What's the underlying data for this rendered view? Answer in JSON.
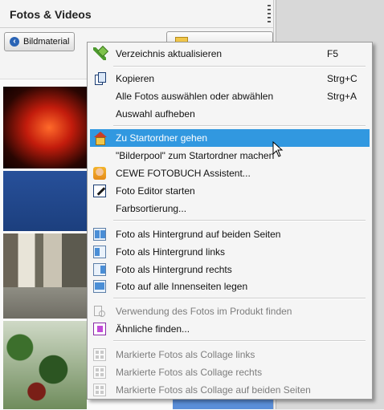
{
  "panel": {
    "title": "Fotos & Videos",
    "back_label": "Bildmaterial"
  },
  "menu": {
    "items": [
      {
        "label": "Verzeichnis aktualisieren",
        "shortcut": "F5",
        "icon": "refresh-icon"
      },
      {
        "label": "Kopieren",
        "shortcut": "Strg+C",
        "icon": "copy-icon"
      },
      {
        "label": "Alle Fotos auswählen oder abwählen",
        "shortcut": "Strg+A"
      },
      {
        "label": "Auswahl aufheben"
      },
      {
        "label": "Zu Startordner gehen",
        "icon": "home-folder-icon",
        "highlighted": true
      },
      {
        "label": "\"Bilderpool\" zum Startordner machen"
      },
      {
        "label": "CEWE FOTOBUCH Assistent...",
        "icon": "cewe-assistant-icon"
      },
      {
        "label": "Foto Editor starten",
        "icon": "photo-editor-icon"
      },
      {
        "label": "Farbsortierung..."
      },
      {
        "label": "Foto als Hintergrund auf beiden Seiten",
        "icon": "background-both-icon"
      },
      {
        "label": "Foto als Hintergrund links",
        "icon": "background-left-icon"
      },
      {
        "label": "Foto als Hintergrund rechts",
        "icon": "background-right-icon"
      },
      {
        "label": "Foto auf alle Innenseiten legen",
        "icon": "inner-pages-icon"
      },
      {
        "label": "Verwendung des Fotos im Produkt finden",
        "icon": "find-usage-icon",
        "disabled": true
      },
      {
        "label": "Ähnliche finden...",
        "icon": "find-similar-icon"
      },
      {
        "label": "Markierte Fotos als Collage links",
        "icon": "collage-left-icon",
        "disabled": true
      },
      {
        "label": "Markierte Fotos als Collage rechts",
        "icon": "collage-right-icon",
        "disabled": true
      },
      {
        "label": "Markierte Fotos als Collage auf beiden Seiten",
        "icon": "collage-both-icon",
        "disabled": true
      }
    ]
  },
  "colors": {
    "highlight": "#3198e0",
    "disabled_text": "#7d7d7d"
  }
}
